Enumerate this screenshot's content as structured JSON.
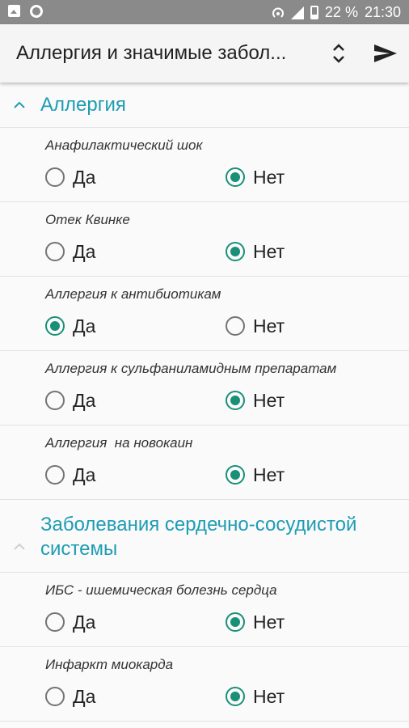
{
  "status_bar": {
    "battery": "22 %",
    "time": "21:30",
    "network": "4G"
  },
  "toolbar": {
    "title": "Аллергия и значимые забол..."
  },
  "colors": {
    "accent": "#1e9cb4",
    "radio_checked": "#1a8f78",
    "status_bar": "#8a8a8a"
  },
  "sections": [
    {
      "title": "Аллергия",
      "questions": [
        {
          "label": "Анафилактический шок",
          "yes": "Да",
          "no": "Нет",
          "selected": "no"
        },
        {
          "label": "Отек Квинке",
          "yes": "Да",
          "no": "Нет",
          "selected": "no"
        },
        {
          "label": "Аллергия к антибиотикам",
          "yes": "Да",
          "no": "Нет",
          "selected": "yes"
        },
        {
          "label": "Аллергия к сульфаниламидным препаратам",
          "yes": "Да",
          "no": "Нет",
          "selected": "no"
        },
        {
          "label": "Аллергия  на новокаин",
          "yes": "Да",
          "no": "Нет",
          "selected": "no"
        }
      ]
    },
    {
      "title_line1": "Заболевания сердечно-сосудистой",
      "title_line2": "системы",
      "questions": [
        {
          "label": "ИБС - ишемическая болезнь сердца",
          "yes": "Да",
          "no": "Нет",
          "selected": "no"
        },
        {
          "label": "Инфаркт миокарда",
          "yes": "Да",
          "no": "Нет",
          "selected": "no"
        }
      ]
    }
  ]
}
